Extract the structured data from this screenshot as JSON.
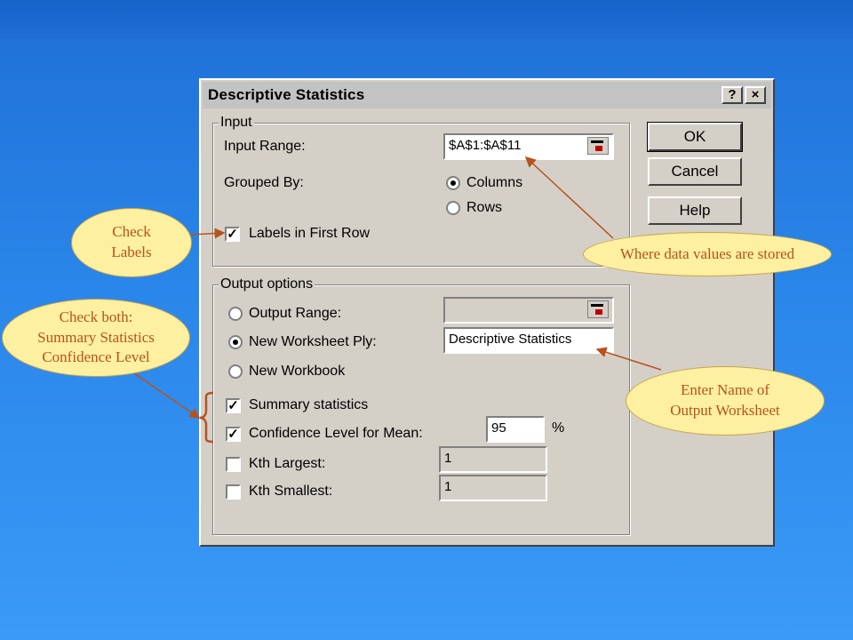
{
  "dialog": {
    "title": "Descriptive Statistics",
    "help_button": "?",
    "close_button": "×",
    "input": {
      "legend": "Input",
      "input_range_label": "Input Range:",
      "input_range_value": "$A$1:$A$11",
      "grouped_by_label": "Grouped By:",
      "columns_label": "Columns",
      "rows_label": "Rows",
      "labels_first_row": "Labels in First Row"
    },
    "output": {
      "legend": "Output options",
      "output_range": "Output Range:",
      "output_range_value": "",
      "new_ply": "New Worksheet Ply:",
      "new_ply_value": "Descriptive Statistics",
      "new_workbook": "New Workbook",
      "summary_statistics": "Summary statistics",
      "confidence_level": "Confidence Level for Mean:",
      "confidence_value": "95",
      "percent": "%",
      "kth_largest": "Kth Largest:",
      "kth_largest_value": "1",
      "kth_smallest": "Kth Smallest:",
      "kth_smallest_value": "1"
    },
    "buttons": {
      "ok": "OK",
      "cancel": "Cancel",
      "help": "Help"
    },
    "state": {
      "grouped_by": "Columns",
      "labels_first_row": true,
      "output_option": "New Worksheet Ply",
      "summary_statistics": true,
      "confidence_level": true,
      "kth_largest": false,
      "kth_smallest": false
    }
  },
  "callouts": {
    "check_labels": [
      "Check",
      "Labels"
    ],
    "check_both": [
      "Check both:",
      "Summary Statistics",
      "Confidence Level"
    ],
    "data_values": "Where data values are stored",
    "enter_name": [
      "Enter Name of",
      "Output Worksheet"
    ]
  },
  "colors": {
    "background": "#2a86ea",
    "dialog_face": "#d4d0c8",
    "callout_fill": "#fdf0a0",
    "callout_text": "#b8521c",
    "arrow": "#b8521c"
  }
}
